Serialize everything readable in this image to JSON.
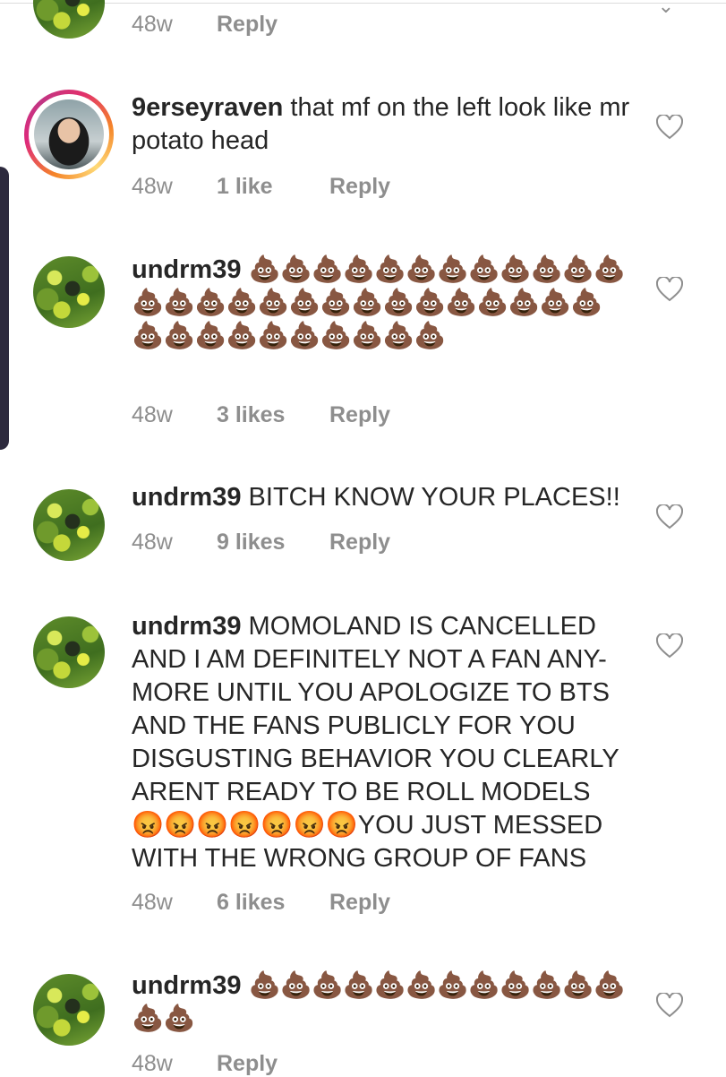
{
  "comments": [
    {
      "username": "",
      "text": "",
      "time": "48w",
      "likes": "",
      "reply": "Reply"
    },
    {
      "username": "9erseyraven",
      "text": " that mf on the left look like mr potato head",
      "time": "48w",
      "likes": "1 like",
      "reply": "Reply"
    },
    {
      "username": "undrm39",
      "text": "",
      "emoji_count": 37,
      "emoji": "💩",
      "time": "48w",
      "likes": "3 likes",
      "reply": "Reply"
    },
    {
      "username": "undrm39",
      "text": " BITCH KNOW YOUR PLACES!!",
      "time": "48w",
      "likes": "9 likes",
      "reply": "Reply"
    },
    {
      "username": "undrm39",
      "text": " MOMOLAND IS CANCELLED AND I AM DEFINITELY NOT A FAN ANY-MORE UNTIL YOU APOLOGIZE TO BTS AND THE FANS PUBLICLY FOR YOU DISGUSTING BEHAVIOR YOU CLEARLY ARENT READY TO BE ROLL MODELS 😡😡😡😡😡😡😡YOU JUST MESSED WITH THE WRONG GROUP OF FANS",
      "time": "48w",
      "likes": "6 likes",
      "reply": "Reply"
    },
    {
      "username": "undrm39",
      "text": "",
      "emoji_count": 14,
      "emoji": "💩",
      "time": "48w",
      "likes": "",
      "reply": "Reply"
    }
  ],
  "icons": {
    "like": "heart-outline-icon",
    "collapse": "chevron-down-icon"
  },
  "colors": {
    "text": "#262626",
    "secondary": "#8e8e8e",
    "story_ring_start": "#f58529",
    "story_ring_end": "#dd2a7b"
  }
}
